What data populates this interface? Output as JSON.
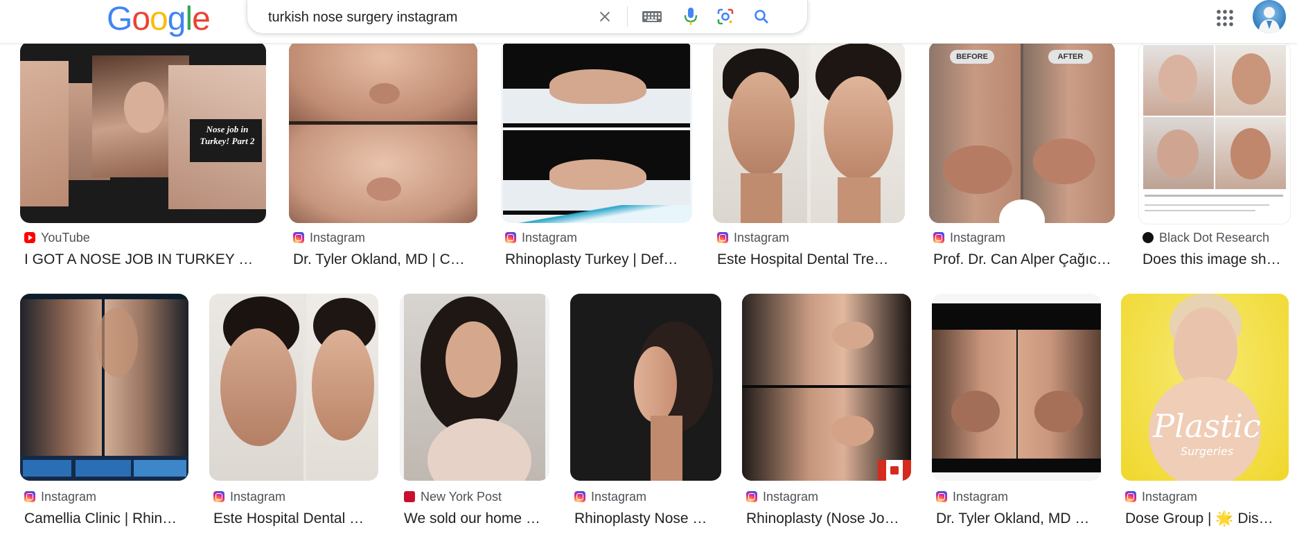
{
  "header": {
    "logo": [
      "G",
      "o",
      "o",
      "g",
      "l",
      "e"
    ],
    "logo_colors": [
      "#4285F4",
      "#EA4335",
      "#FBBC05",
      "#4285F4",
      "#34A853",
      "#EA4335"
    ],
    "query": "turkish nose surgery instagram"
  },
  "icons": {
    "clear": "close-icon",
    "keyboard": "keyboard-icon",
    "voice": "microphone-icon",
    "lens": "google-lens-icon",
    "search": "search-icon",
    "apps": "apps-grid-icon",
    "account": "account-avatar"
  },
  "colors": {
    "blue": "#4285F4",
    "red": "#EA4335",
    "yellow": "#FBBC05",
    "green": "#34A853",
    "instagram": "#d6249f",
    "youtube": "#ff0000"
  },
  "results": [
    {
      "source": "YouTube",
      "title": "I GOT A NOSE JOB IN TURKEY …",
      "source_icon": "youtube-icon",
      "thumb_text": "Nose job in Turkey! Part 2"
    },
    {
      "source": "Instagram",
      "title": "Dr. Tyler Okland, MD | C…",
      "source_icon": "instagram-icon"
    },
    {
      "source": "Instagram",
      "title": "Rhinoplasty Turkey | Def…",
      "source_icon": "instagram-icon"
    },
    {
      "source": "Instagram",
      "title": "Este Hospital Dental Tre…",
      "source_icon": "instagram-icon"
    },
    {
      "source": "Instagram",
      "title": "Prof. Dr. Can Alper Çağıc…",
      "source_icon": "instagram-icon",
      "thumb_text": [
        "BEFORE",
        "AFTER"
      ]
    },
    {
      "source": "Black Dot Research",
      "title": "Does this image sh…",
      "source_icon": "black-dot-icon"
    },
    {
      "source": "Instagram",
      "title": "Camellia Clinic | Rhin…",
      "source_icon": "instagram-icon"
    },
    {
      "source": "Instagram",
      "title": "Este Hospital Dental …",
      "source_icon": "instagram-icon"
    },
    {
      "source": "New York Post",
      "title": "We sold our home …",
      "source_icon": "new-york-post-icon"
    },
    {
      "source": "Instagram",
      "title": "Rhinoplasty Nose …",
      "source_icon": "instagram-icon"
    },
    {
      "source": "Instagram",
      "title": "Rhinoplasty (Nose Jo…",
      "source_icon": "instagram-icon"
    },
    {
      "source": "Instagram",
      "title": "Dr. Tyler Okland, MD …",
      "source_icon": "instagram-icon"
    },
    {
      "source": "Instagram",
      "title": "Dose Group | 🌟 Dis…",
      "source_icon": "instagram-icon",
      "thumb_text": [
        "Plastic",
        "Surgeries"
      ]
    }
  ]
}
